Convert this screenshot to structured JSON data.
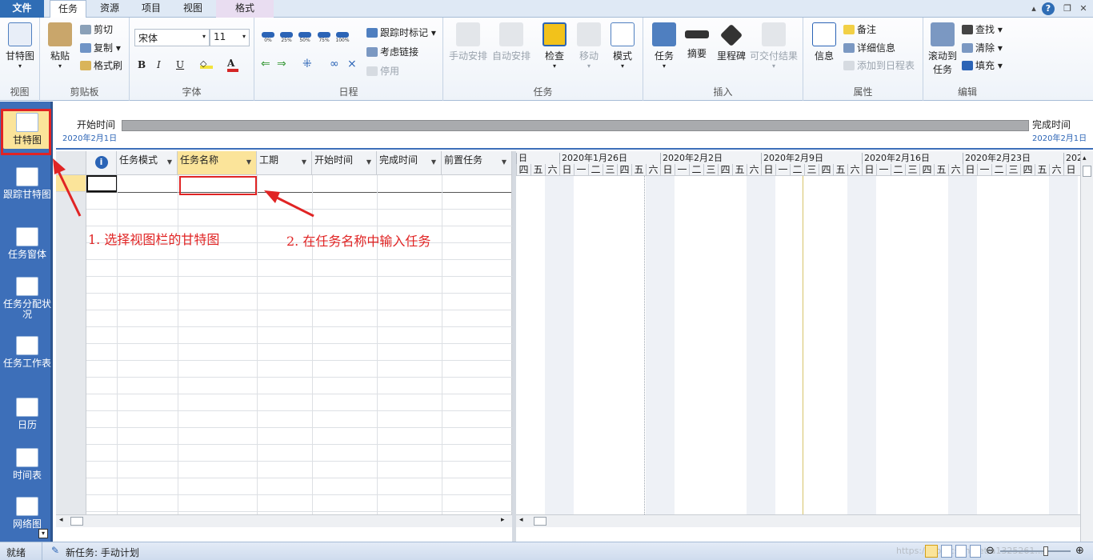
{
  "tabs": {
    "file": "文件",
    "task": "任务",
    "resource": "资源",
    "project": "项目",
    "view": "视图",
    "format": "格式"
  },
  "ribbon": {
    "view": {
      "gantt": "甘特图",
      "label": "视图"
    },
    "clipboard": {
      "paste": "粘贴",
      "cut": "剪切",
      "copy": "复制",
      "format_painter": "格式刷",
      "label": "剪贴板"
    },
    "font": {
      "name": "宋体",
      "size": "11",
      "bold": "B",
      "italic": "I",
      "underline": "U",
      "font_color": "A",
      "label": "字体"
    },
    "schedule": {
      "pcts": [
        "0%",
        "25%",
        "50%",
        "75%",
        "100%"
      ],
      "track_mark": "跟踪时标记",
      "respect_links": "考虑链接",
      "inactivate": "停用",
      "label": "日程"
    },
    "tasks": {
      "manual": "手动安排",
      "auto": "自动安排",
      "inspect": "检查",
      "move": "移动",
      "mode": "模式",
      "label": "任务"
    },
    "insert": {
      "task": "任务",
      "summary": "摘要",
      "milestone": "里程碑",
      "deliverable": "可交付结果",
      "label": "插入"
    },
    "properties": {
      "info": "信息",
      "notes": "备注",
      "details": "详细信息",
      "add_timeline": "添加到日程表",
      "label": "属性"
    },
    "editing": {
      "scroll_to_task_1": "滚动到",
      "scroll_to_task_2": "任务",
      "find": "查找",
      "clear": "清除",
      "fill": "填充",
      "label": "编辑"
    }
  },
  "views": [
    {
      "label": "甘特图"
    },
    {
      "label": "跟踪甘特图"
    },
    {
      "label": "任务窗体"
    },
    {
      "label": "任务分配状况"
    },
    {
      "label": "任务工作表"
    },
    {
      "label": "日历"
    },
    {
      "label": "时间表"
    },
    {
      "label": "网络图"
    }
  ],
  "timeline": {
    "start_label": "开始时间",
    "start_date": "2020年2月1日",
    "finish_label": "完成时间",
    "finish_date": "2020年2月1日"
  },
  "grid": {
    "columns": [
      "任务模式",
      "任务名称",
      "工期",
      "开始时间",
      "完成时间",
      "前置任务"
    ],
    "info_icon": "i"
  },
  "chart": {
    "weeks": [
      "日",
      "2020年1月26日",
      "2020年2月2日",
      "2020年2月9日",
      "2020年2月16日",
      "2020年2月23日",
      "202"
    ],
    "days": [
      "四",
      "五",
      "六",
      "日",
      "一",
      "二",
      "三",
      "四",
      "五",
      "六",
      "日",
      "一",
      "二",
      "三",
      "四",
      "五",
      "六",
      "日",
      "一",
      "二",
      "三",
      "四",
      "五",
      "六",
      "日",
      "一",
      "二",
      "三",
      "四",
      "五",
      "六",
      "日",
      "一",
      "二",
      "三",
      "四",
      "五",
      "六",
      "日"
    ]
  },
  "annotations": {
    "step1": "1. 选择视图栏的甘特图",
    "step2": "2. 在任务名称中输入任务"
  },
  "status": {
    "ready": "就绪",
    "new_task": "新任务: 手动计划",
    "watermark": "https://blog.csdn.net/a1325261..."
  },
  "colors": {
    "accent": "#3d6fb9",
    "annotation": "#e02424"
  }
}
